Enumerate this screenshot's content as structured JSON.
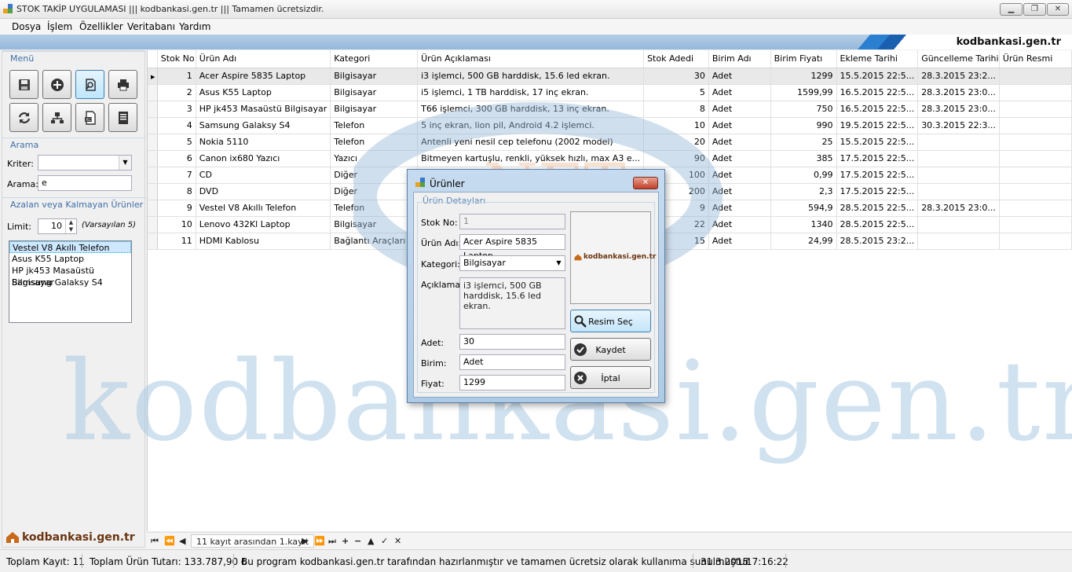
{
  "window": {
    "title": "STOK TAKİP UYGULAMASI ||| kodbankasi.gen.tr ||| Tamamen ücretsizdir.",
    "controls": [
      "minimize",
      "maximize",
      "close"
    ]
  },
  "menu": [
    "Dosya",
    "İşlem",
    "Özellikler",
    "Veritabanı",
    "Yardım"
  ],
  "banner": {
    "site": "kodbankasi.gen.tr"
  },
  "sidebar": {
    "menu_label": "Menü",
    "toolbar_icons": [
      "save-icon",
      "add-icon",
      "search-icon",
      "print-icon",
      "refresh-icon",
      "network-icon",
      "export-icon",
      "report-icon"
    ],
    "search": {
      "label": "Arama",
      "criteria_label": "Kriter:",
      "criteria_value": "",
      "query_label": "Arama:",
      "query_value": "e"
    },
    "low_stock": {
      "label": "Azalan veya Kalmayan Ürünler",
      "limit_label": "Limit:",
      "limit_value": "10",
      "default_note": "(Varsayılan 5)",
      "items": [
        "Vestel V8 Akıllı Telefon",
        "Asus K55 Laptop",
        "HP jk453 Masaüstü Bilgisayar",
        "Samsung Galaksy S4"
      ]
    },
    "logo": "kodbankasi.gen.tr"
  },
  "grid": {
    "columns": [
      "Stok No",
      "Ürün Adı",
      "Kategori",
      "Ürün Açıklaması",
      "Stok Adedi",
      "Birim Adı",
      "Birim Fiyatı",
      "Ekleme Tarihi",
      "Güncelleme Tarihi",
      "Ürün Resmi"
    ],
    "rows": [
      [
        "1",
        "Acer Aspire 5835 Laptop",
        "Bilgisayar",
        "i3 işlemci, 500 GB harddisk, 15.6 led ekran.",
        "30",
        "Adet",
        "1299",
        "15.5.2015 22:5...",
        "28.3.2015 23:2...",
        ""
      ],
      [
        "2",
        "Asus K55 Laptop",
        "Bilgisayar",
        "i5 işlemci, 1 TB harddisk, 17 inç ekran.",
        "5",
        "Adet",
        "1599,99",
        "16.5.2015 22:5...",
        "28.3.2015 23:0...",
        ""
      ],
      [
        "3",
        "HP jk453 Masaüstü Bilgisayar",
        "Bilgisayar",
        "T66 işlemci, 300 GB harddisk, 13 inç ekran.",
        "8",
        "Adet",
        "750",
        "16.5.2015 22:5...",
        "28.3.2015 23:0...",
        ""
      ],
      [
        "4",
        "Samsung Galaksy S4",
        "Telefon",
        "5 inç ekran, lion pil, Android 4.2 işlemci.",
        "10",
        "Adet",
        "990",
        "19.5.2015 22:5...",
        "30.3.2015 22:3...",
        ""
      ],
      [
        "5",
        "Nokia 5110",
        "Telefon",
        "Antenli yeni nesil cep telefonu (2002 model)",
        "20",
        "Adet",
        "25",
        "15.5.2015 22:5...",
        "",
        ""
      ],
      [
        "6",
        "Canon ix680 Yazıcı",
        "Yazıcı",
        "Bitmeyen kartuşlu, renkli, yüksek hızlı, max A3 e...",
        "90",
        "Adet",
        "385",
        "17.5.2015 22:5...",
        "",
        ""
      ],
      [
        "7",
        "CD",
        "Diğer",
        "",
        "100",
        "Adet",
        "0,99",
        "17.5.2015 22:5...",
        "",
        ""
      ],
      [
        "8",
        "DVD",
        "Diğer",
        "",
        "200",
        "Adet",
        "2,3",
        "17.5.2015 22:5...",
        "",
        ""
      ],
      [
        "9",
        "Vestel V8 Akıllı Telefon",
        "Telefon",
        "",
        "9",
        "Adet",
        "594,9",
        "28.5.2015 22:5...",
        "28.3.2015 23:0...",
        ""
      ],
      [
        "10",
        "Lenovo 432Kl Laptop",
        "Bilgisayar",
        "",
        "22",
        "Adet",
        "1340",
        "28.5.2015 22:5...",
        "",
        ""
      ],
      [
        "11",
        "HDMI Kablosu",
        "Bağlantı Araçları",
        "",
        "15",
        "Adet",
        "24,99",
        "28.5.2015 23:2...",
        "",
        ""
      ]
    ]
  },
  "navigator": {
    "record_text": "11 kayıt arasından 1.kayıt"
  },
  "status": {
    "total_records": "Toplam Kayıt: 11",
    "total_amount": "Toplam Ürün Tutarı: 133.787,90 ₺",
    "message": "Bu program kodbankasi.gen.tr tarafından hazırlanmıştır ve tamamen ücretsiz olarak kullanıma sunulmuştur.",
    "date": "31.3.2015",
    "time": "17:16:22"
  },
  "watermark": {
    "text": "kodbankasi.gen.tr",
    "net": "NET"
  },
  "dialog": {
    "title": "Ürünler",
    "group_label": "Ürün Detayları",
    "stock_no_label": "Stok No:",
    "stock_no": "1",
    "name_label": "Ürün Adı:",
    "name": "Acer Aspire 5835 Laptop",
    "category_label": "Kategori:",
    "category": "Bilgisayar",
    "desc_label": "Açıklama:",
    "desc": "i3 işlemci, 500 GB harddisk, 15.6 led ekran.",
    "qty_label": "Adet:",
    "qty": "30",
    "unit_label": "Birim:",
    "unit": "Adet",
    "price_label": "Fiyat:",
    "price": "1299",
    "image_logo": "kodbankasi.gen.tr",
    "btn_image": "Resim Seç",
    "btn_save": "Kaydet",
    "btn_cancel": "İptal"
  }
}
